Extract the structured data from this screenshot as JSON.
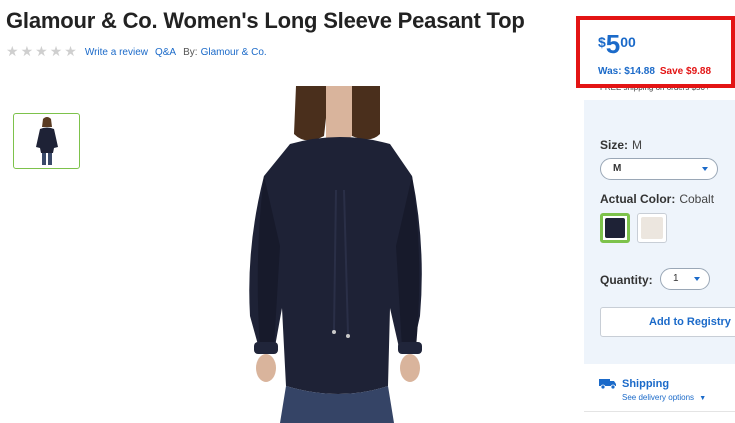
{
  "product": {
    "title": "Glamour & Co. Women's Long Sleeve Peasant Top",
    "rating_stars": 0,
    "write_review": "Write a review",
    "qa": "Q&A",
    "by_label": "By:",
    "brand": "Glamour & Co."
  },
  "price": {
    "currency": "$",
    "whole": "5",
    "cents": "00",
    "was_label": "Was: $14.88",
    "save_label": "Save $9.88",
    "free_shipping": "FREE shipping on orders $50+"
  },
  "options": {
    "size_label": "Size:",
    "size_value": "M",
    "size_selected": "M",
    "color_label": "Actual Color:",
    "color_value": "Cobalt",
    "swatches": [
      "#1e2236",
      "#ece6df"
    ],
    "quantity_label": "Quantity:",
    "quantity_value": "1",
    "registry_button": "Add to Registry"
  },
  "shipping": {
    "title": "Shipping",
    "subtitle": "See delivery options"
  },
  "colors": {
    "accent_blue": "#1b6ac9",
    "highlight_red": "#e31414",
    "selected_green": "#7dc24b"
  }
}
